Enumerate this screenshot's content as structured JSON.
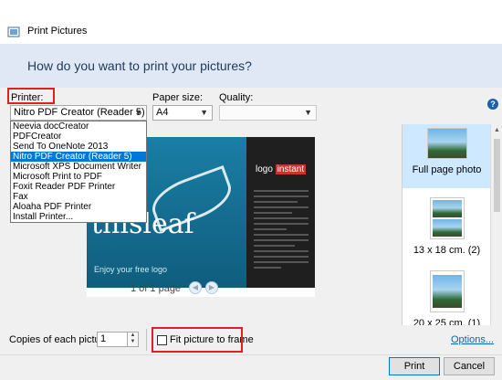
{
  "window": {
    "title": "Print Pictures"
  },
  "header": {
    "question": "How do you want to print your pictures?"
  },
  "printer": {
    "label": "Printer:",
    "selected": "Nitro PDF Creator (Reader 5)",
    "options": [
      "Neevia docCreator",
      "PDFCreator",
      "Send To OneNote 2013",
      "Nitro PDF Creator (Reader 5)",
      "Microsoft XPS Document Writer",
      "Microsoft Print to PDF",
      "Foxit Reader PDF Printer",
      "Fax",
      "Aloaha PDF Printer",
      "Install Printer..."
    ],
    "selected_index": 3
  },
  "paper_size": {
    "label": "Paper size:",
    "value": "A4"
  },
  "quality": {
    "label": "Quality:",
    "value": ""
  },
  "preview": {
    "brand_word": "thisleaf",
    "tagline": "Enjoy your free logo",
    "logo_text_1": "logo",
    "logo_text_2": "instant",
    "page_indicator": "1 of 1 page"
  },
  "layouts": [
    {
      "label": "Full page photo",
      "selected": true
    },
    {
      "label": "13 x 18 cm. (2)",
      "selected": false
    },
    {
      "label": "20 x 25 cm. (1)",
      "selected": false
    }
  ],
  "copies": {
    "label": "Copies of each picture:",
    "value": "1"
  },
  "fit": {
    "label": "Fit picture to frame",
    "checked": false
  },
  "links": {
    "options": "Options..."
  },
  "buttons": {
    "print": "Print",
    "cancel": "Cancel"
  },
  "help_glyph": "?",
  "colors": {
    "highlight": "#e21f26",
    "accent": "#0078d7",
    "header_band": "#dfe8f4"
  }
}
